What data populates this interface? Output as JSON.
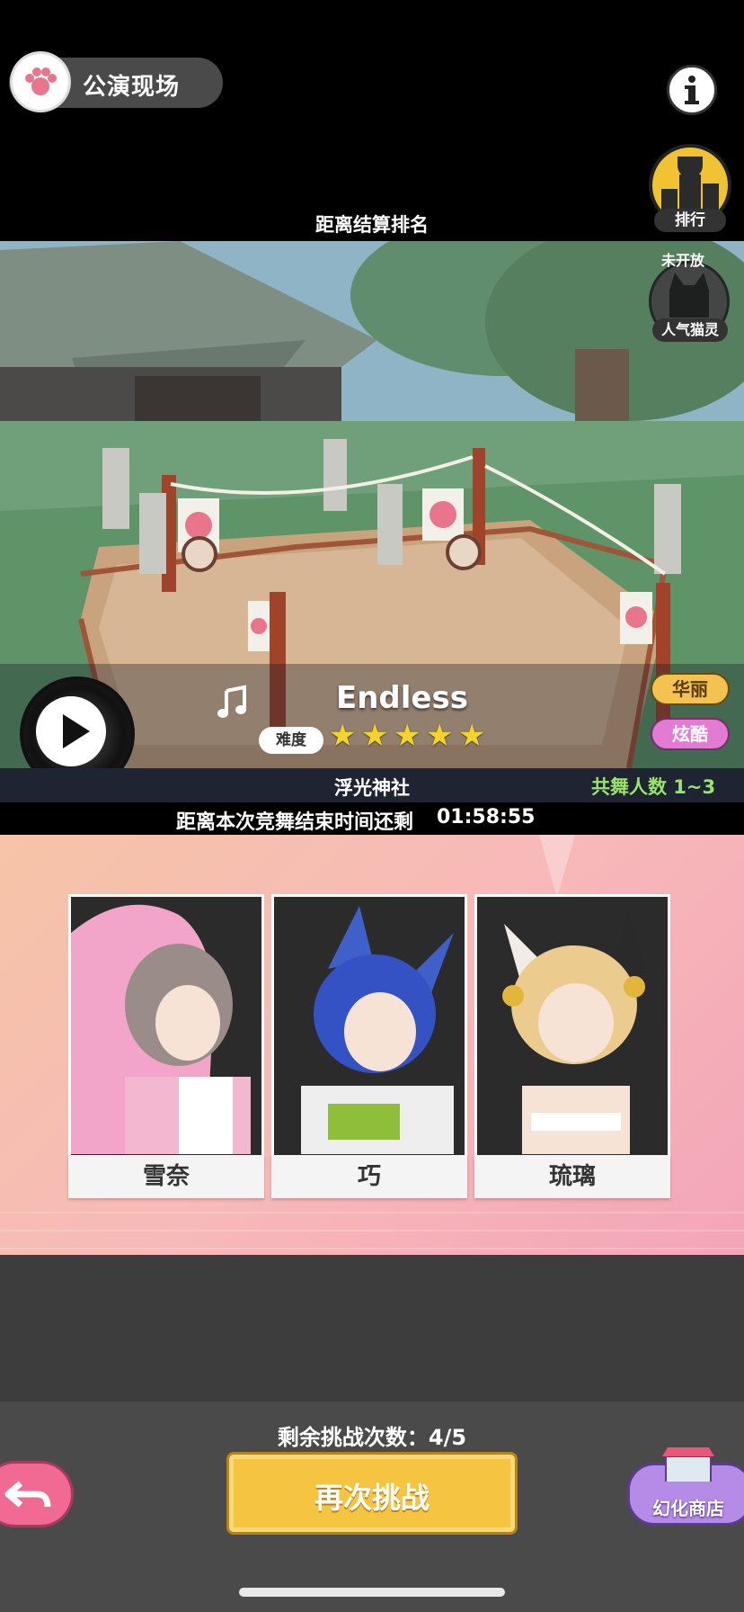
{
  "header": {
    "title": "公演现场",
    "rank_label": "排行",
    "settle_text": "距离结算排名"
  },
  "locked": {
    "status": "未开放",
    "label": "人气猫灵"
  },
  "song": {
    "title": "Endless",
    "difficulty_label": "难度",
    "difficulty_stars": 5,
    "tags": [
      "华丽",
      "炫酷"
    ]
  },
  "stage": {
    "name": "浮光神社",
    "dancer_count": "共舞人数 1~3",
    "timer_label": "距离本次竞舞结束时间还剩",
    "timer_value": "01:58:55"
  },
  "characters": [
    {
      "name": "雪奈"
    },
    {
      "name": "巧"
    },
    {
      "name": "琉璃"
    }
  ],
  "footer": {
    "remaining": "剩余挑战次数：4/5",
    "retry_label": "再次挑战",
    "shop_label": "幻化商店"
  },
  "colors": {
    "accent_gold": "#f5c441",
    "star": "#f6d32a",
    "dancer_count_green": "#9be36a",
    "panel_pink": "#f7b9b9"
  }
}
